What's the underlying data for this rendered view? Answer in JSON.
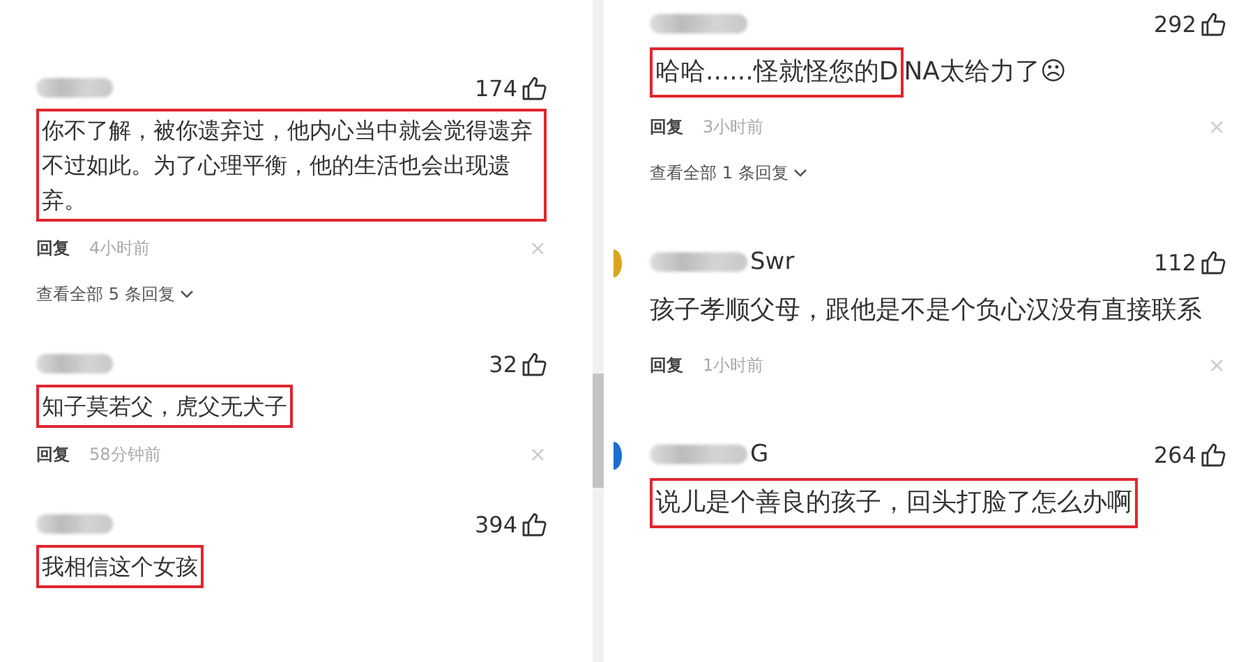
{
  "panels": [
    {
      "comments": [
        {
          "likes": "174",
          "segments": [
            {
              "text": "你不了解，被你遗弃过，他内心当中就会觉得遗弃不过如此。为了心理平衡，他的生活也会出现遗弃。",
              "highlighted": true
            }
          ],
          "reply": "回复",
          "time": "4小时前",
          "close": "×",
          "view_replies": "查看全部 5 条回复"
        },
        {
          "likes": "32",
          "segments": [
            {
              "text": "知子莫若父，虎父无犬子",
              "highlighted": true
            }
          ],
          "reply": "回复",
          "time": "58分钟前",
          "close": "×"
        },
        {
          "likes": "394",
          "segments": [
            {
              "text": "我相信这个女孩",
              "highlighted": true
            }
          ]
        }
      ]
    },
    {
      "comments": [
        {
          "likes": "292",
          "segments": [
            {
              "text": "哈哈......怪就怪您的D",
              "highlighted": true
            },
            {
              "text": "NA太给力了☹",
              "highlighted": false
            }
          ],
          "reply": "回复",
          "time": "3小时前",
          "close": "×",
          "view_replies": "查看全部 1 条回复"
        },
        {
          "avatar": true,
          "name_suffix": "Swr",
          "likes": "112",
          "segments": [
            {
              "text": "孩子孝顺父母，跟他是不是个负心汉没有直接联系",
              "highlighted": false
            }
          ],
          "reply": "回复",
          "time": "1小时前",
          "close": "×"
        },
        {
          "avatar": true,
          "name_suffix": "G",
          "likes": "264",
          "segments": [
            {
              "text": "说儿是个善良的孩子，回头打脸了怎么办啊",
              "highlighted": true
            }
          ]
        }
      ]
    }
  ]
}
